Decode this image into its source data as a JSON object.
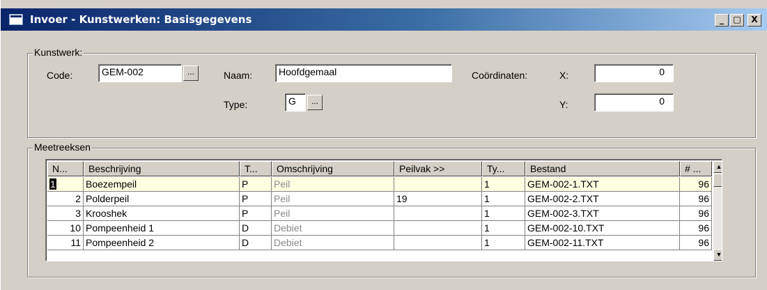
{
  "window": {
    "title": "Invoer - Kunstwerken: Basisgegevens",
    "minimize_label": "_",
    "maximize_label": "□",
    "close_label": "X"
  },
  "kunstwerk": {
    "group_label": "Kunstwerk:",
    "code_label": "Code:",
    "code_value": "GEM-002",
    "naam_label": "Naam:",
    "naam_value": "Hoofdgemaal",
    "type_label": "Type:",
    "type_value": "G",
    "coord_label": "Coördinaten:",
    "x_label": "X:",
    "x_value": "0",
    "y_label": "Y:",
    "y_value": "0",
    "browse_label": "..."
  },
  "meetreeksen": {
    "group_label": "Meetreeksen",
    "columns": [
      "N...",
      "Beschrijving",
      "T...",
      "Omschrijving",
      "Peilvak >>",
      "Ty...",
      "Bestand",
      "# ..."
    ],
    "rows": [
      {
        "n": "1",
        "beschrijving": "Boezempeil",
        "t": "P",
        "omschrijving": "Peil",
        "peilvak": "",
        "ty": "1",
        "bestand": "GEM-002-1.TXT",
        "count": "96"
      },
      {
        "n": "2",
        "beschrijving": "Polderpeil",
        "t": "P",
        "omschrijving": "Peil",
        "peilvak": "19",
        "ty": "1",
        "bestand": "GEM-002-2.TXT",
        "count": "96"
      },
      {
        "n": "3",
        "beschrijving": "Krooshek",
        "t": "P",
        "omschrijving": "Peil",
        "peilvak": "",
        "ty": "1",
        "bestand": "GEM-002-3.TXT",
        "count": "96"
      },
      {
        "n": "10",
        "beschrijving": "Pompeenheid 1",
        "t": "D",
        "omschrijving": "Debiet",
        "peilvak": "",
        "ty": "1",
        "bestand": "GEM-002-10.TXT",
        "count": "96"
      },
      {
        "n": "11",
        "beschrijving": "Pompeenheid 2",
        "t": "D",
        "omschrijving": "Debiet",
        "peilvak": "",
        "ty": "1",
        "bestand": "GEM-002-11.TXT",
        "count": "96"
      }
    ],
    "scroll_up": "▲",
    "scroll_down": "▼"
  },
  "colors": {
    "title_start": "#0a246a",
    "title_end": "#a6caf0",
    "face": "#d4d0c8",
    "selected_row": "#ffffe1"
  }
}
